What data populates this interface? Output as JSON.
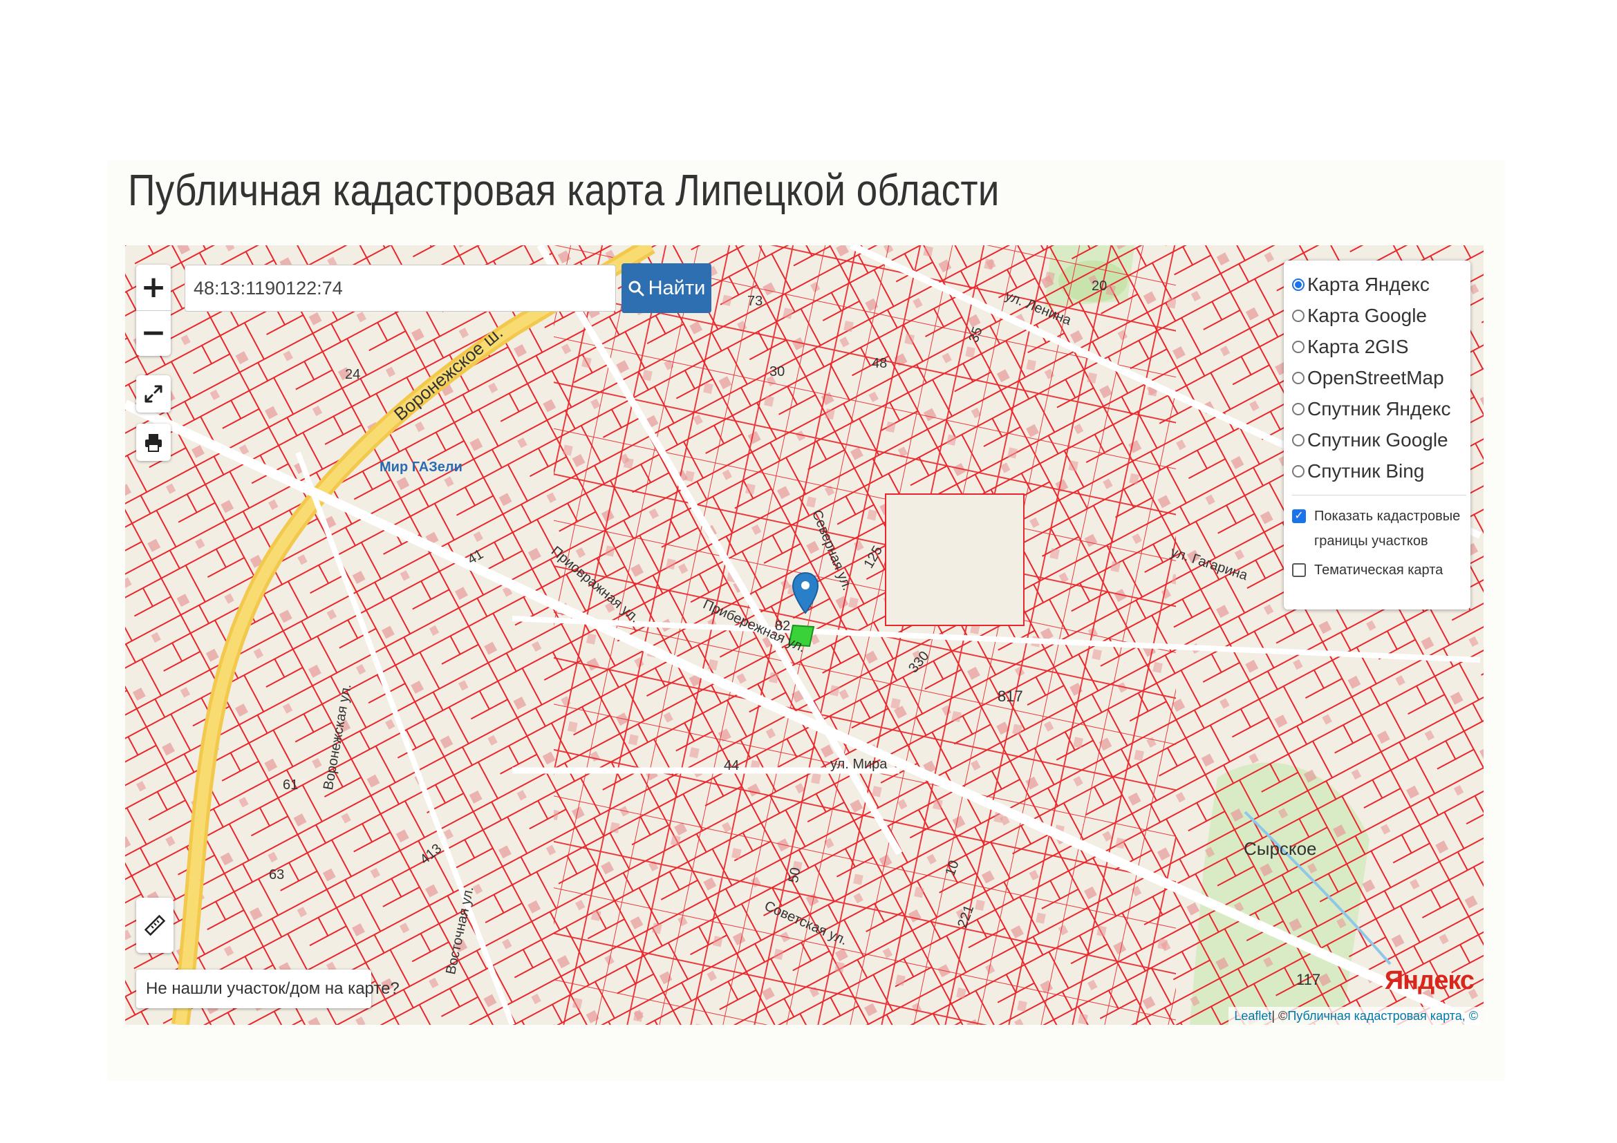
{
  "page": {
    "title": "Публичная кадастровая карта Липецкой области"
  },
  "search": {
    "value": "48:13:1190122:74",
    "button_label": "Найти"
  },
  "zoom": {
    "in_label": "+",
    "out_label": "−"
  },
  "layers": {
    "base_maps": [
      {
        "label": "Карта Яндекс",
        "selected": true
      },
      {
        "label": "Карта Google",
        "selected": false
      },
      {
        "label": "Карта 2GIS",
        "selected": false
      },
      {
        "label": "OpenStreetMap",
        "selected": false
      },
      {
        "label": "Спутник Яндекс",
        "selected": false
      },
      {
        "label": "Спутник Google",
        "selected": false
      },
      {
        "label": "Спутник Bing",
        "selected": false
      }
    ],
    "overlays": [
      {
        "label": "Показать кадастровые границы участков",
        "checked": true
      },
      {
        "label": "Тематическая карта",
        "checked": false
      }
    ]
  },
  "not_found_button": "Не нашли участок/дом на карте?",
  "attribution": {
    "leaflet": "Leaflet",
    "separator": " | © ",
    "source": "Публичная кадастровая карта, ©"
  },
  "map_labels": {
    "brand": "Яндекс",
    "district": "Сырское",
    "poi": "Мир ГАЗели",
    "streets": [
      "Воронежское ш.",
      "ул. Ленина",
      "Советская ул.",
      "ул. Мира",
      "Северная ул.",
      "Прибережная ул.",
      "Приовражная ул.",
      "ул. Гагарина",
      "Воронежская ул.",
      "Восточная ул."
    ],
    "parcel_numbers": [
      "817",
      "330",
      "20",
      "35",
      "73",
      "24",
      "48",
      "10",
      "413",
      "221",
      "125",
      "117",
      "61",
      "63",
      "50",
      "44",
      "82",
      "41",
      "30"
    ]
  },
  "colors": {
    "parcel_border": "#e8262b",
    "button": "#2e6fb1",
    "marker": "#2a80c8",
    "selected_parcel": "#39d239"
  },
  "icons": {
    "search": "magnifier-icon",
    "fullscreen": "expand-icon",
    "print": "printer-icon",
    "ruler": "ruler-icon",
    "marker": "map-marker-icon"
  }
}
